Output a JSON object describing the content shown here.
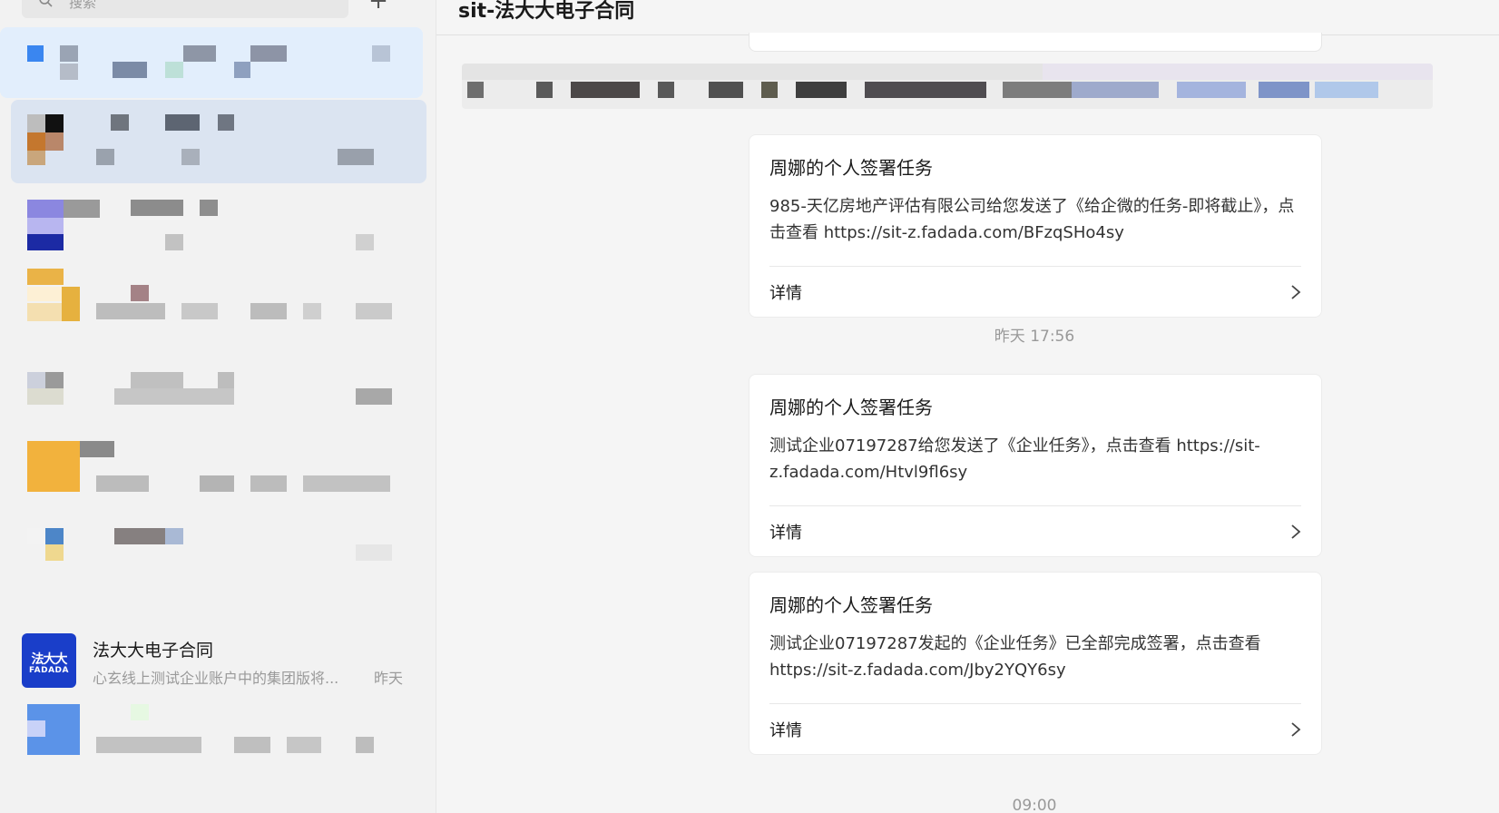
{
  "sidebar": {
    "search": {
      "placeholder": "搜索"
    },
    "add_label": "+",
    "fadada_conversation": {
      "avatar_cn": "法大大",
      "avatar_en": "FADADA",
      "name": "法大大电子合同",
      "preview": "心玄线上测试企业账户中的集团版将...",
      "time": "昨天"
    },
    "colors": {
      "selected": "#dbe4f1",
      "brand": "#1a3ec9"
    }
  },
  "header": {
    "title": "sit-法大大电子合同"
  },
  "messages": [
    {
      "title": "周娜的个人签署任务",
      "body": "985-天亿房地产评估有限公司给您发送了《给企微的任务-即将截止》，点击查看 https://sit-z.fadada.com/BFzqSHo4sy",
      "detail": "详情"
    },
    {
      "title": "周娜的个人签署任务",
      "body": "测试企业07197287给您发送了《企业任务》，点击查看 https://sit-z.fadada.com/Htvl9fl6sy",
      "detail": "详情"
    },
    {
      "title": "周娜的个人签署任务",
      "body": "测试企业07197287发起的《企业任务》已全部完成签署，点击查看 https://sit-z.fadada.com/Jby2YQY6sy",
      "detail": "详情"
    }
  ],
  "timestamps": [
    "昨天 17:56",
    "09:00"
  ]
}
